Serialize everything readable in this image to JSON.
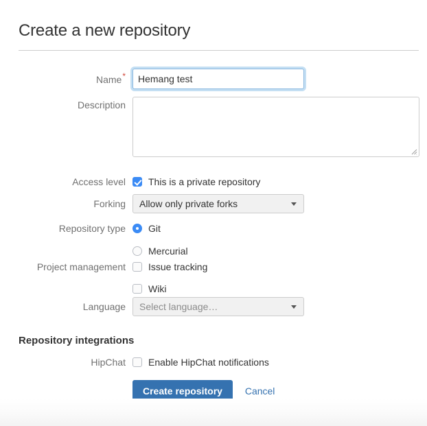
{
  "header": {
    "title": "Create a new repository"
  },
  "form": {
    "name": {
      "label": "Name",
      "required_marker": "*",
      "value": "Hemang test",
      "placeholder": ""
    },
    "description": {
      "label": "Description",
      "value": "",
      "placeholder": ""
    },
    "access_level": {
      "label": "Access level",
      "option_label": "This is a private repository",
      "checked": true
    },
    "forking": {
      "label": "Forking",
      "selected": "Allow only private forks"
    },
    "repository_type": {
      "label": "Repository type",
      "options": [
        {
          "label": "Git",
          "selected": true
        },
        {
          "label": "Mercurial",
          "selected": false
        }
      ]
    },
    "project_management": {
      "label": "Project management",
      "options": [
        {
          "label": "Issue tracking",
          "checked": false
        },
        {
          "label": "Wiki",
          "checked": false
        }
      ]
    },
    "language": {
      "label": "Language",
      "selected": "Select language…",
      "is_placeholder": true
    }
  },
  "integrations": {
    "heading": "Repository integrations",
    "hipchat": {
      "label": "HipChat",
      "option_label": "Enable HipChat notifications",
      "checked": false
    }
  },
  "actions": {
    "submit_label": "Create repository",
    "cancel_label": "Cancel"
  },
  "colors": {
    "primary_button": "#3572b0",
    "link": "#3572b0",
    "control_accent": "#3b8bf5",
    "required_star": "#d04437",
    "label_text": "#707070",
    "focus_ring": "#c4dff3"
  }
}
